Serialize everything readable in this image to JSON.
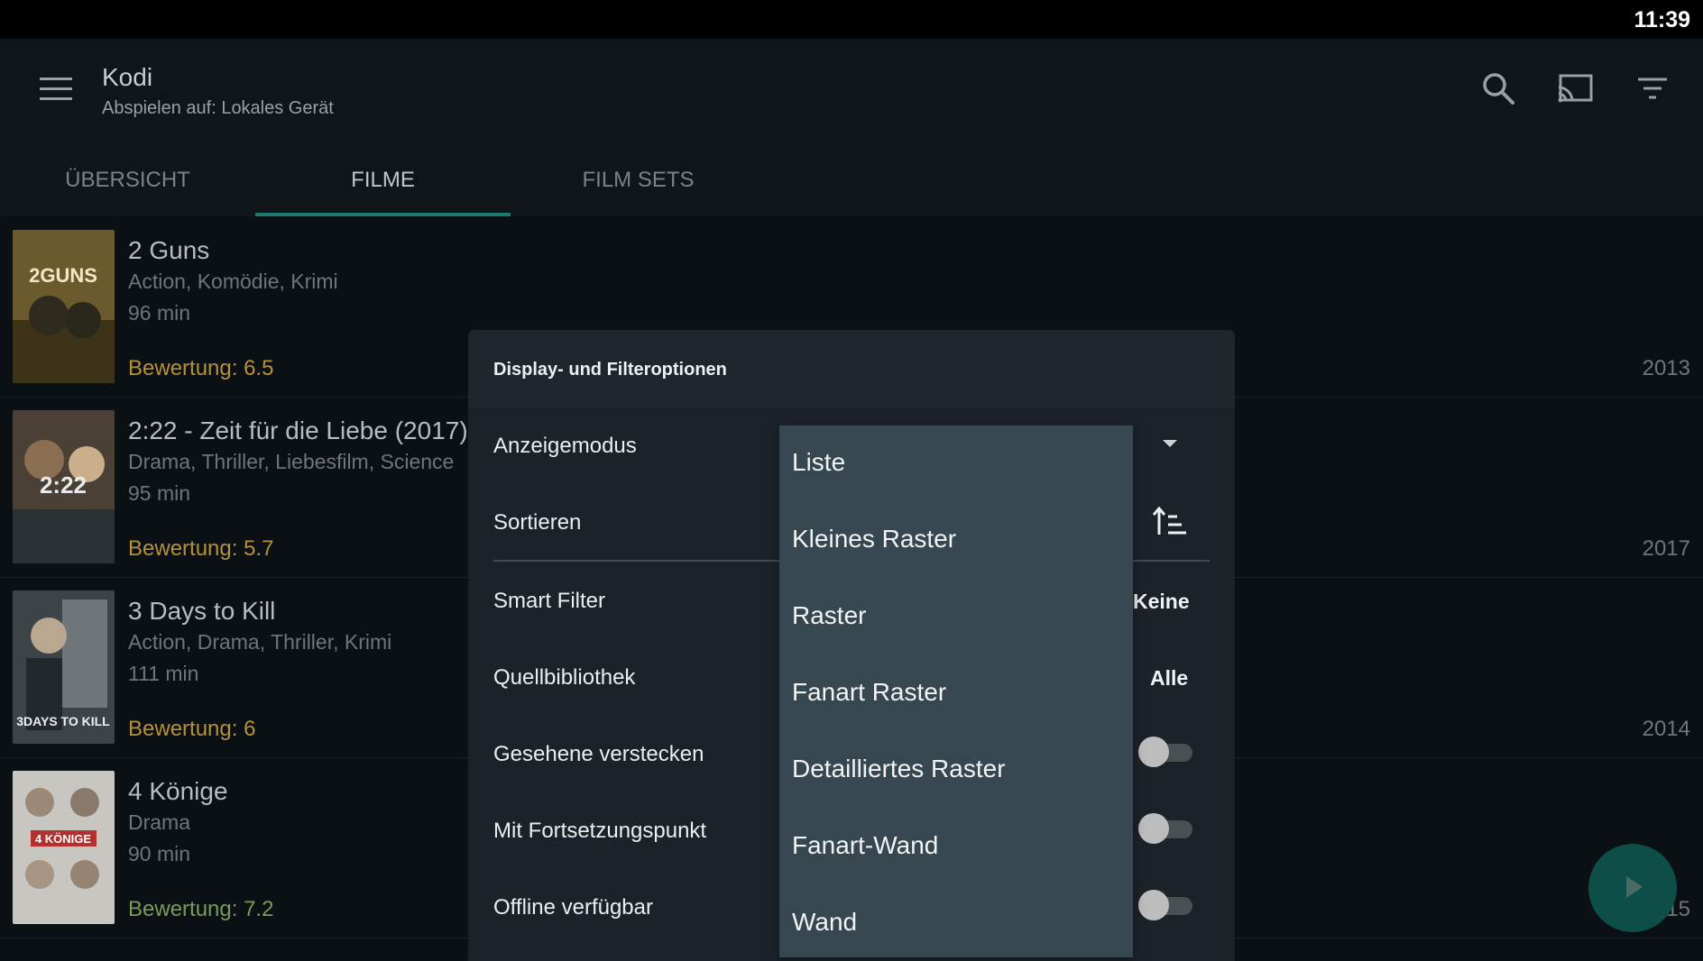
{
  "status_bar": {
    "time": "11:39"
  },
  "app_bar": {
    "title": "Kodi",
    "subtitle": "Abspielen auf: Lokales Gerät",
    "icons": [
      "menu-icon",
      "search-icon",
      "cast-icon",
      "filter-icon"
    ]
  },
  "tabs": [
    {
      "label": "ÜBERSICHT",
      "active": false
    },
    {
      "label": "FILME",
      "active": true
    },
    {
      "label": "FILM SETS",
      "active": false
    }
  ],
  "movies": [
    {
      "title": "2 Guns",
      "genres": "Action, Komödie, Krimi",
      "duration": "96  min",
      "rating": "Bewertung: 6.5",
      "year": "2013",
      "poster_text": "2GUNS"
    },
    {
      "title": "2:22 - Zeit für die Liebe (2017)",
      "genres": "Drama, Thriller, Liebesfilm, Science",
      "duration": "95  min",
      "rating": "Bewertung: 5.7",
      "year": "2017",
      "poster_text": "2:22"
    },
    {
      "title": "3 Days to Kill",
      "genres": "Action, Drama, Thriller, Krimi",
      "duration": "111  min",
      "rating": "Bewertung: 6",
      "year": "2014",
      "poster_text": "3DAYS TO KILL"
    },
    {
      "title": "4 Könige",
      "genres": "Drama",
      "duration": "90  min",
      "rating": "Bewertung: 7.2",
      "year": "15",
      "poster_text": "4 KÖNIGE"
    }
  ],
  "dialog": {
    "title": "Display- und Filteroptionen",
    "options": {
      "display_mode": {
        "label": "Anzeigemodus"
      },
      "sort": {
        "label": "Sortieren"
      },
      "smart_filter": {
        "label": "Smart Filter",
        "value": "Keine"
      },
      "source_library": {
        "label": "Quellbibliothek",
        "value": "Alle"
      },
      "hide_watched": {
        "label": "Gesehene verstecken",
        "on": false
      },
      "resume_point": {
        "label": "Mit Fortsetzungspunkt",
        "on": false
      },
      "offline": {
        "label": "Offline verfügbar",
        "on": false
      }
    },
    "dropdown_items": [
      "Liste",
      "Kleines Raster",
      "Raster",
      "Fanart Raster",
      "Detailliertes Raster",
      "Fanart-Wand",
      "Wand"
    ]
  },
  "colors": {
    "accent": "#1b7a6e",
    "rating": "#b7913a",
    "dropdown_bg": "#37474f",
    "dialog_bg": "#1b2329"
  }
}
